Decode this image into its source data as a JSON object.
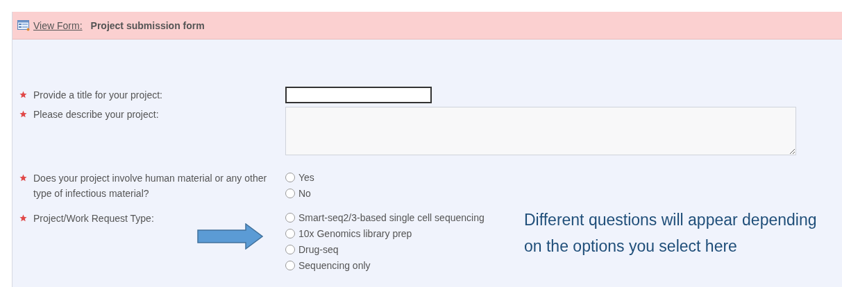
{
  "header": {
    "link": "View Form:",
    "title": "Project submission form"
  },
  "questions": [
    {
      "kind": "text",
      "required": true,
      "label": "Provide a title for your project:"
    },
    {
      "kind": "textarea",
      "required": true,
      "label": "Please describe your project:"
    },
    {
      "kind": "radio",
      "required": true,
      "label": "Does your project involve human material or any other type of infectious material?",
      "options": [
        {
          "label": "Yes",
          "selected": false
        },
        {
          "label": "No",
          "selected": false
        }
      ]
    },
    {
      "kind": "radio",
      "required": true,
      "label": "Project/Work Request Type:",
      "options": [
        {
          "label": "Smart-seq2/3-based single cell sequencing",
          "selected": false
        },
        {
          "label": "10x Genomics library prep",
          "selected": false
        },
        {
          "label": "Drug-seq",
          "selected": false
        },
        {
          "label": "Sequencing only",
          "selected": false
        }
      ]
    }
  ],
  "annotation": {
    "text": "Different questions will appear depending on the options you select here"
  }
}
